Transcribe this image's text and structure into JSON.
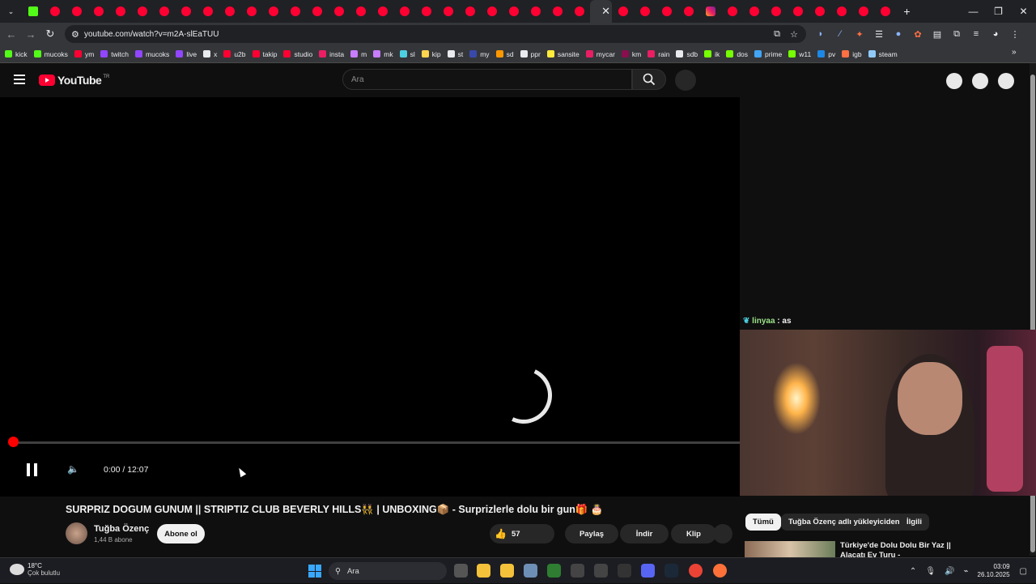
{
  "browser": {
    "url": "youtube.com/watch?v=m2A-slEaTUU",
    "new_tab": "+",
    "close_tab": "✕",
    "bookmarks": [
      {
        "label": "kick",
        "color": "#53fc18"
      },
      {
        "label": "mucoks",
        "color": "#53fc18"
      },
      {
        "label": "ym",
        "color": "#ff0033"
      },
      {
        "label": "twitch",
        "color": "#9146ff"
      },
      {
        "label": "mucoks",
        "color": "#9146ff"
      },
      {
        "label": "live",
        "color": "#9146ff"
      },
      {
        "label": "x",
        "color": "#e8eaed"
      },
      {
        "label": "u2b",
        "color": "#ff0033"
      },
      {
        "label": "takip",
        "color": "#ff0033"
      },
      {
        "label": "studio",
        "color": "#ff0033"
      },
      {
        "label": "insta",
        "color": "#e91e63"
      },
      {
        "label": "m",
        "color": "#c77dff"
      },
      {
        "label": "mk",
        "color": "#c77dff"
      },
      {
        "label": "sl",
        "color": "#4dd0e1"
      },
      {
        "label": "kip",
        "color": "#ffd54f"
      },
      {
        "label": "st",
        "color": "#e8eaed"
      },
      {
        "label": "my",
        "color": "#3949ab"
      },
      {
        "label": "sd",
        "color": "#ff9800"
      },
      {
        "label": "ppr",
        "color": "#e8eaed"
      },
      {
        "label": "sansite",
        "color": "#ffeb3b"
      },
      {
        "label": "mycar",
        "color": "#e91e63"
      },
      {
        "label": "km",
        "color": "#880e4f"
      },
      {
        "label": "rain",
        "color": "#e91e63"
      },
      {
        "label": "sdb",
        "color": "#e8eaed"
      },
      {
        "label": "ik",
        "color": "#76ff03"
      },
      {
        "label": "dos",
        "color": "#76ff03"
      },
      {
        "label": "prime",
        "color": "#42a5f5"
      },
      {
        "label": "w11",
        "color": "#76ff03"
      },
      {
        "label": "pv",
        "color": "#1e88e5"
      },
      {
        "label": "igb",
        "color": "#ff7043"
      },
      {
        "label": "steam",
        "color": "#90caf9"
      }
    ]
  },
  "youtube": {
    "logo_text": "YouTube",
    "country": "TR",
    "search_placeholder": "Ara"
  },
  "player": {
    "time": "0:00 / 12:07",
    "progress": 0
  },
  "overlay": {
    "chat_user": "linyaa",
    "chat_sep": " : ",
    "chat_text": "as"
  },
  "video": {
    "title": "SURPRIZ DOGUM GUNUM || STRIPTIZ CLUB BEVERLY HILLS👯 | UNBOXING📦 - Surprizlerle dolu bir gun🎁 🎂",
    "channel": "Tuğba Özenç",
    "subscribers": "1,44 B abone",
    "subscribe": "Abone ol",
    "likes": "57",
    "share": "Paylaş",
    "download": "İndir",
    "clip": "Klip"
  },
  "sidebar": {
    "chips": [
      "Tümü",
      "Tuğba Özenç adlı yükleyiciden",
      "İlgili"
    ],
    "rec_title": "Türkiye'de Dolu Dolu Bir Yaz ||",
    "rec_title2": "Alaçatı Ev Turu -"
  },
  "taskbar": {
    "temp": "18°C",
    "weather": "Çok bulutlu",
    "search": "Ara",
    "time": "03:09",
    "date": "26.10.2025"
  }
}
